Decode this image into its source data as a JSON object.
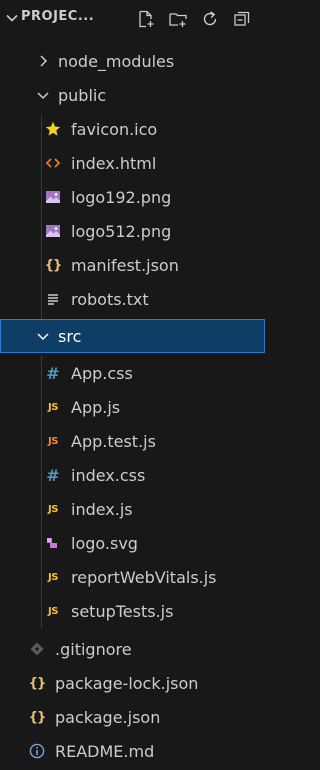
{
  "explorer": {
    "title": "PROJEC...",
    "icons": [
      "chevron-down-icon",
      "new-file-icon",
      "new-folder-icon",
      "refresh-icon",
      "collapse-all-icon"
    ]
  },
  "tree": [
    {
      "name": "node_modules",
      "type": "folder",
      "state": "collapsed"
    },
    {
      "name": "public",
      "type": "folder",
      "state": "expanded"
    },
    {
      "name": "favicon.ico",
      "type": "file",
      "icon": "star-icon"
    },
    {
      "name": "index.html",
      "type": "file",
      "icon": "html-icon"
    },
    {
      "name": "logo192.png",
      "type": "file",
      "icon": "image-icon"
    },
    {
      "name": "logo512.png",
      "type": "file",
      "icon": "image-icon"
    },
    {
      "name": "manifest.json",
      "type": "file",
      "icon": "json-icon"
    },
    {
      "name": "robots.txt",
      "type": "file",
      "icon": "text-icon"
    },
    {
      "name": "src",
      "type": "folder",
      "state": "expanded",
      "selected": true
    },
    {
      "name": "App.css",
      "type": "file",
      "icon": "css-icon"
    },
    {
      "name": "App.js",
      "type": "file",
      "icon": "js-icon"
    },
    {
      "name": "App.test.js",
      "type": "file",
      "icon": "js-test-icon"
    },
    {
      "name": "index.css",
      "type": "file",
      "icon": "css-icon"
    },
    {
      "name": "index.js",
      "type": "file",
      "icon": "js-icon"
    },
    {
      "name": "logo.svg",
      "type": "file",
      "icon": "svg-icon"
    },
    {
      "name": "reportWebVitals.js",
      "type": "file",
      "icon": "js-icon"
    },
    {
      "name": "setupTests.js",
      "type": "file",
      "icon": "js-icon"
    },
    {
      "name": ".gitignore",
      "type": "file",
      "icon": "git-icon"
    },
    {
      "name": "package-lock.json",
      "type": "file",
      "icon": "json-icon"
    },
    {
      "name": "package.json",
      "type": "file",
      "icon": "json-icon"
    },
    {
      "name": "README.md",
      "type": "file",
      "icon": "info-icon"
    }
  ],
  "icon_glyphs": {
    "js": "JS",
    "hash": "#",
    "braces": "{}"
  },
  "colors": {
    "background": "#181818",
    "text": "#cccccc",
    "selected_bg": "#0e3d66",
    "selected_border": "#2b79d0",
    "js": "#f1c232",
    "js_test": "#f0883e",
    "css": "#519aba",
    "html": "#e37933",
    "image": "#a074c4",
    "json": "#e5c07b",
    "star": "#f1d21d",
    "svg": "#c678dd",
    "git": "#5a5a5a",
    "info": "#6fa8dc"
  }
}
